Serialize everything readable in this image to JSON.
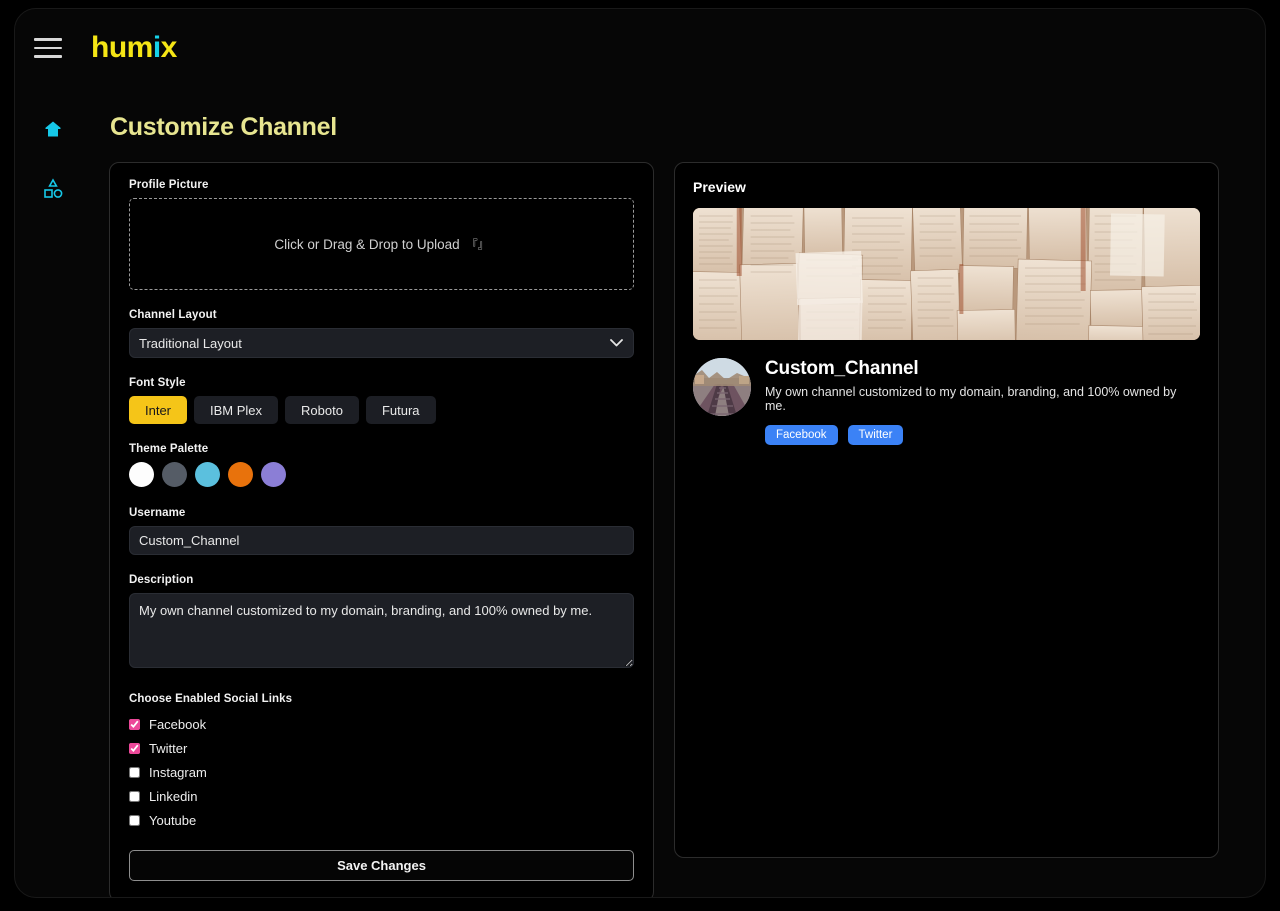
{
  "header": {
    "menu_icon": "hamburger-icon",
    "logo_main": "hum",
    "logo_accent": "i",
    "logo_tail": "x"
  },
  "sidebar": {
    "items": [
      {
        "name": "home",
        "icon": "home-icon"
      },
      {
        "name": "shapes",
        "icon": "shapes-icon"
      }
    ]
  },
  "page": {
    "title": "Customize Channel"
  },
  "form": {
    "profile_picture_label": "Profile Picture",
    "dropzone_text": "Click or Drag & Drop to Upload",
    "dropzone_glyph": "『』",
    "channel_layout_label": "Channel Layout",
    "channel_layout_value": "Traditional Layout",
    "channel_layout_options": [
      "Traditional Layout"
    ],
    "font_style_label": "Font Style",
    "font_styles": [
      {
        "label": "Inter",
        "selected": true
      },
      {
        "label": "IBM Plex",
        "selected": false
      },
      {
        "label": "Roboto",
        "selected": false
      },
      {
        "label": "Futura",
        "selected": false
      }
    ],
    "theme_palette_label": "Theme Palette",
    "theme_colors": [
      "#fdfdfd",
      "#555c66",
      "#5bc0de",
      "#e8720c",
      "#8b7ed6"
    ],
    "username_label": "Username",
    "username_value": "Custom_Channel",
    "description_label": "Description",
    "description_value": "My own channel customized to my domain, branding, and 100% owned by me.",
    "social_links_label": "Choose Enabled Social Links",
    "social_links": [
      {
        "label": "Facebook",
        "checked": true
      },
      {
        "label": "Twitter",
        "checked": true
      },
      {
        "label": "Instagram",
        "checked": false
      },
      {
        "label": "Linkedin",
        "checked": false
      },
      {
        "label": "Youtube",
        "checked": false
      }
    ],
    "save_label": "Save Changes"
  },
  "preview": {
    "title": "Preview",
    "banner_alt": "old-book-pages-banner",
    "avatar_alt": "railway-track-avatar",
    "channel_name": "Custom_Channel",
    "channel_description": "My own channel customized to my domain, branding, and 100% owned by me.",
    "badges": [
      "Facebook",
      "Twitter"
    ]
  },
  "colors": {
    "logo_yellow": "#f5e515",
    "logo_cyan": "#16d1e8",
    "title_khaki": "#e7e590",
    "accent_yellow": "#f5c518",
    "checkbox_pink": "#ec4899",
    "badge_blue": "#3b82f6",
    "sidebar_icon": "#16c8e8"
  }
}
